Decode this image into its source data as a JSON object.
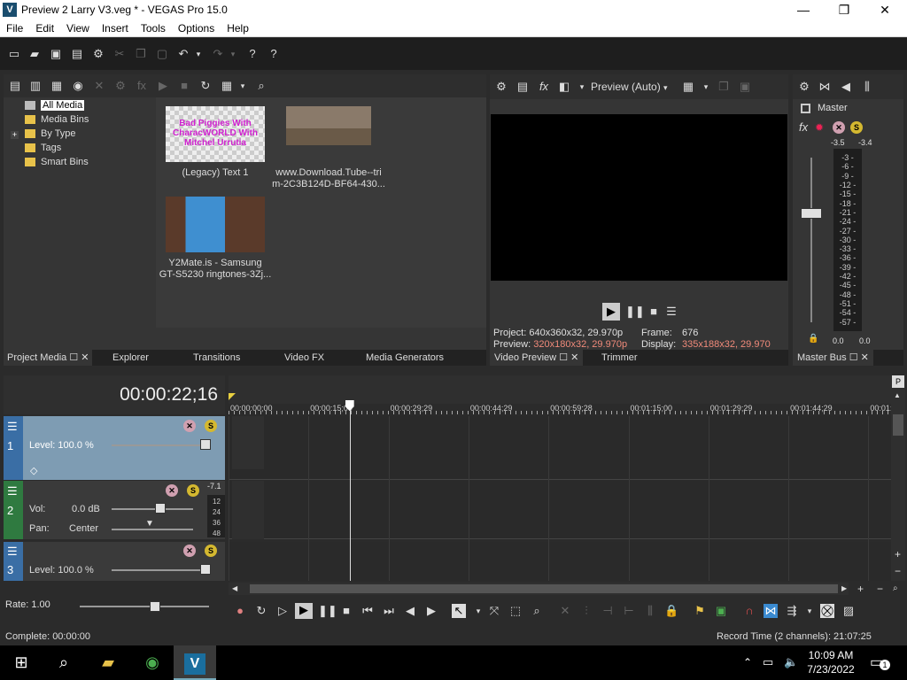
{
  "window": {
    "title": "Preview 2 Larry V3.veg * - VEGAS Pro 15.0",
    "app_icon": "V",
    "minimize": "—",
    "maximize": "❐",
    "close": "✕"
  },
  "menu": [
    "File",
    "Edit",
    "View",
    "Insert",
    "Tools",
    "Options",
    "Help"
  ],
  "project_media": {
    "tree": [
      {
        "label": "All Media",
        "selected": true
      },
      {
        "label": "Media Bins"
      },
      {
        "label": "By Type",
        "expander": "+"
      },
      {
        "label": "Tags"
      },
      {
        "label": "Smart Bins"
      }
    ],
    "items": [
      {
        "caption_1": "(Legacy) Text 1",
        "caption_2": "",
        "thumb_text": "Bad Piggies With CharacWORLD With Mitchel Urrutia"
      },
      {
        "caption_1": "www.Download.Tube--tri",
        "caption_2": "m-2C3B124D-BF64-430..."
      },
      {
        "caption_1": "Y2Mate.is - Samsung",
        "caption_2": "GT-S5230 ringtones-3Zj..."
      }
    ],
    "tabs": [
      "Project Media",
      "Explorer",
      "Transitions",
      "Video FX",
      "Media Generators"
    ]
  },
  "preview": {
    "mode": "Preview (Auto)",
    "project_label": "Project:",
    "project_value": "640x360x32, 29.970p",
    "frame_label": "Frame:",
    "frame_value": "676",
    "preview_label": "Preview:",
    "preview_value": "320x180x32, 29.970p",
    "display_label": "Display:",
    "display_value": "335x188x32, 29.970",
    "tabs": [
      "Video Preview",
      "Trimmer"
    ]
  },
  "master": {
    "label": "Master",
    "peak_left": "-3.5",
    "peak_right": "-3.4",
    "scale": [
      "3",
      "6",
      "9",
      "12",
      "15",
      "18",
      "21",
      "24",
      "27",
      "30",
      "33",
      "36",
      "39",
      "42",
      "45",
      "48",
      "51",
      "54",
      "57"
    ],
    "bottom_left": "0.0",
    "bottom_right": "0.0",
    "tab": "Master Bus"
  },
  "timeline": {
    "timecode": "00:00:22;16",
    "ruler": [
      "00:00:00;00",
      "00:00:15;00",
      "00:00:29;29",
      "00:00:44;29",
      "00:00:59;28",
      "00:01:15;00",
      "00:01:29;29",
      "00:01:44;29",
      "00:01:"
    ],
    "tracks": [
      {
        "number": "1",
        "level_label": "Level: 100.0 %",
        "color": "#3a6ea5"
      },
      {
        "number": "2",
        "vol_label": "Vol:",
        "vol_value": "0.0 dB",
        "pan_label": "Pan:",
        "pan_value": "Center",
        "peak": "-7.1",
        "scale": [
          "12",
          "24",
          "36",
          "48"
        ],
        "color": "#2f7a40"
      },
      {
        "number": "3",
        "level_label": "Level: 100.0 %",
        "color": "#3a6ea5"
      }
    ],
    "rate": "Rate: 1.00",
    "cursor_fraction": 0.255
  },
  "status": {
    "left": "Complete: 00:00:00",
    "right": "Record Time (2 channels): 21:07:25"
  },
  "taskbar": {
    "time": "10:09 AM",
    "date": "7/23/2022",
    "notifications": "1"
  }
}
